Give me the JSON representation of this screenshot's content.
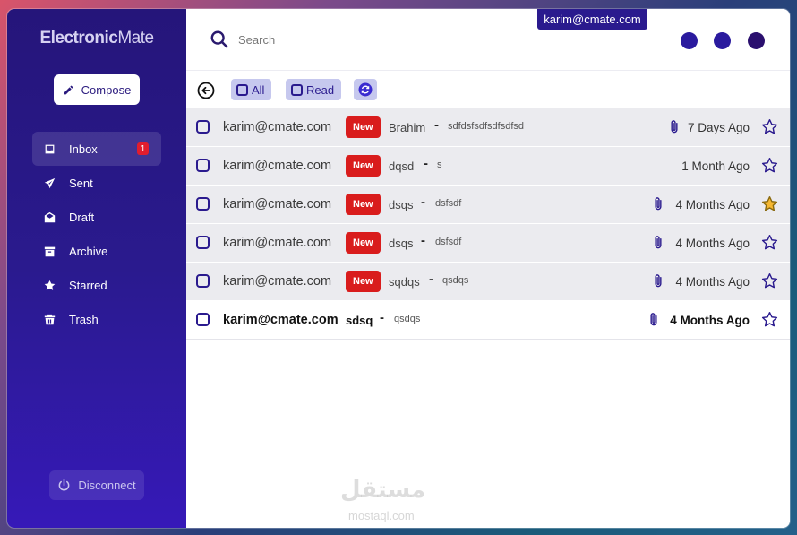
{
  "app": {
    "logo_bold": "Electronic",
    "logo_light": "Mate"
  },
  "sidebar": {
    "compose_label": "Compose",
    "items": [
      {
        "label": "Inbox",
        "icon": "inbox-icon",
        "badge": "1",
        "active": true
      },
      {
        "label": "Sent",
        "icon": "send-icon"
      },
      {
        "label": "Draft",
        "icon": "draft-envelope-icon"
      },
      {
        "label": "Archive",
        "icon": "archive-icon"
      },
      {
        "label": "Starred",
        "icon": "star-icon"
      },
      {
        "label": "Trash",
        "icon": "trash-icon"
      }
    ],
    "disconnect_label": "Disconnect"
  },
  "header": {
    "search_placeholder": "Search",
    "user_email": "karim@cmate.com",
    "dot_colors": [
      "#2a1a9e",
      "#2a1a9e",
      "#2a0f6e"
    ]
  },
  "toolbar": {
    "all_label": "All",
    "read_label": "Read"
  },
  "emails": [
    {
      "from": "karim@cmate.com",
      "new": true,
      "badge": "New",
      "subject": "Brahim",
      "snippet": "sdfdsfsdfsdfsdfsd",
      "attachment": true,
      "date": "7 Days Ago",
      "starred": false,
      "read": false
    },
    {
      "from": "karim@cmate.com",
      "new": true,
      "badge": "New",
      "subject": "dqsd",
      "snippet": "s",
      "attachment": false,
      "date": "1 Month Ago",
      "starred": false,
      "read": false
    },
    {
      "from": "karim@cmate.com",
      "new": true,
      "badge": "New",
      "subject": "dsqs",
      "snippet": "dsfsdf",
      "attachment": true,
      "date": "4 Months Ago",
      "starred": true,
      "read": false
    },
    {
      "from": "karim@cmate.com",
      "new": true,
      "badge": "New",
      "subject": "dsqs",
      "snippet": "dsfsdf",
      "attachment": true,
      "date": "4 Months Ago",
      "starred": false,
      "read": false
    },
    {
      "from": "karim@cmate.com",
      "new": true,
      "badge": "New",
      "subject": "sqdqs",
      "snippet": "qsdqs",
      "attachment": true,
      "date": "4 Months Ago",
      "starred": false,
      "read": false
    },
    {
      "from": "karim@cmate.com",
      "new": false,
      "subject": "sdsq",
      "snippet": "qsdqs",
      "attachment": true,
      "date": "4 Months Ago",
      "starred": false,
      "read": true
    }
  ],
  "watermark": {
    "arabic": "مستقل",
    "latin": "mostaql.com"
  },
  "colors": {
    "brand": "#2a1a8e",
    "new_badge": "#d91c1c",
    "star_active": "#f5b731"
  }
}
